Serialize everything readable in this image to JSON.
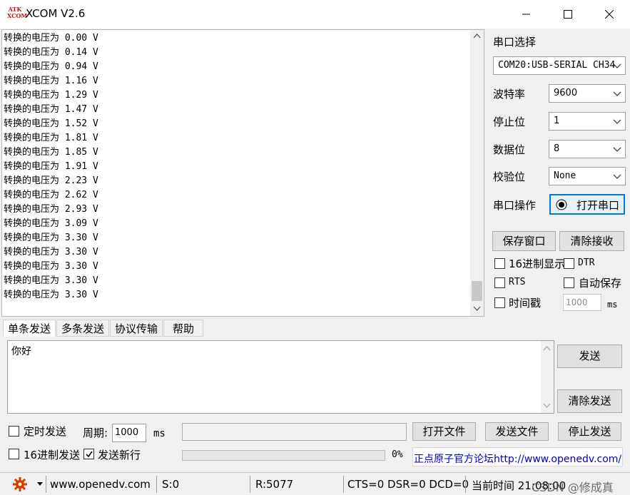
{
  "app": {
    "logo_line1": "ATK",
    "logo_line2": "XCOM",
    "title": "XCOM V2.6"
  },
  "receive": {
    "lines": [
      "转换的电压为 0.00 V",
      "转换的电压为 0.14 V",
      "转换的电压为 0.94 V",
      "转换的电压为 1.16 V",
      "转换的电压为 1.29 V",
      "转换的电压为 1.47 V",
      "转换的电压为 1.52 V",
      "转换的电压为 1.81 V",
      "转换的电压为 1.85 V",
      "转换的电压为 1.91 V",
      "转换的电压为 2.23 V",
      "转换的电压为 2.62 V",
      "转换的电压为 2.93 V",
      "转换的电压为 3.09 V",
      "转换的电压为 3.30 V",
      "转换的电压为 3.30 V",
      "转换的电压为 3.30 V",
      "转换的电压为 3.30 V",
      "转换的电压为 3.30 V"
    ]
  },
  "serial": {
    "port_label": "串口选择",
    "port_value": "COM20:USB-SERIAL CH34",
    "baud_label": "波特率",
    "baud_value": "9600",
    "stop_label": "停止位",
    "stop_value": "1",
    "data_label": "数据位",
    "data_value": "8",
    "parity_label": "校验位",
    "parity_value": "None",
    "op_label": "串口操作",
    "open_button": "打开串口"
  },
  "options": {
    "save_window": "保存窗口",
    "clear_receive": "清除接收",
    "hex_display": "16进制显示",
    "dtr": "DTR",
    "rts": "RTS",
    "auto_save": "自动保存",
    "timestamp": "时间戳",
    "timestamp_ms": "1000",
    "ms_unit": "ms"
  },
  "tabs": [
    "单条发送",
    "多条发送",
    "协议传输",
    "帮助"
  ],
  "send": {
    "text": "你好",
    "send_button": "发送",
    "clear_send_button": "清除发送",
    "timed_send": "定时发送",
    "period_label": "周期:",
    "period_value": "1000",
    "period_unit": "ms",
    "open_file": "打开文件",
    "send_file": "发送文件",
    "stop_send": "停止发送",
    "hex_send": "16进制发送",
    "send_newline": "发送新行",
    "progress": "0%",
    "progress_value": 0,
    "forum_link": "正点原子官方论坛http://www.openedv.com/"
  },
  "status": {
    "url": "www.openedv.com",
    "sent": "S:0",
    "received": "R:5077",
    "signals": "CTS=0 DSR=0 DCD=0",
    "time": "当前时间 21:08:00",
    "watermark": "CSDN @修成真"
  },
  "colors": {
    "accent": "#0078d7",
    "link": "#0000cc",
    "logo_red": "#c0141a",
    "gear_red": "#d83b01"
  }
}
